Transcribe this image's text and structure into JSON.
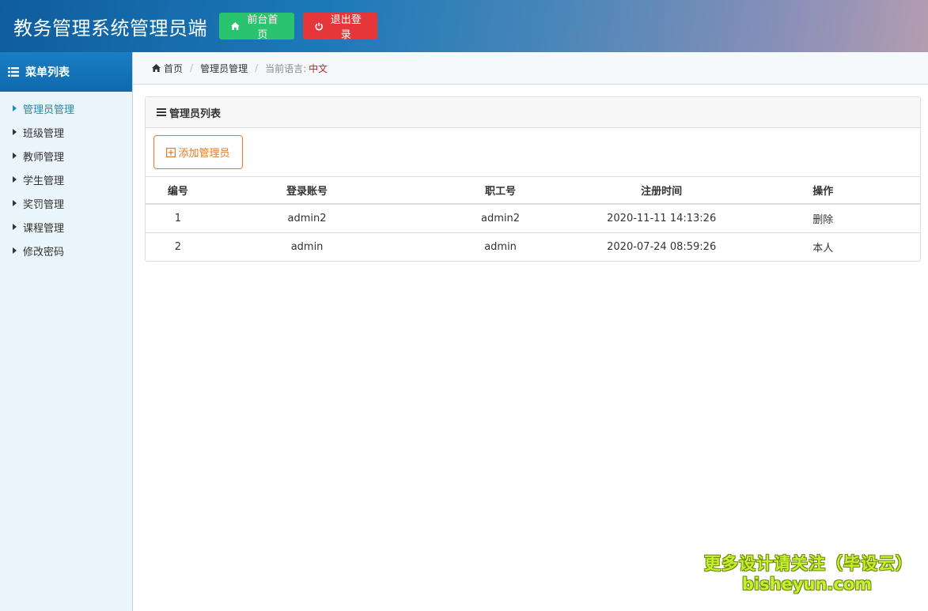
{
  "header": {
    "title": "教务管理系统管理员端",
    "home_button": "前台首页",
    "logout_button": "退出登录"
  },
  "sidebar": {
    "title": "菜单列表",
    "items": [
      {
        "label": "管理员管理",
        "active": true
      },
      {
        "label": "班级管理"
      },
      {
        "label": "教师管理"
      },
      {
        "label": "学生管理"
      },
      {
        "label": "奖罚管理"
      },
      {
        "label": "课程管理"
      },
      {
        "label": "修改密码"
      }
    ]
  },
  "breadcrumb": {
    "home": "首页",
    "current": "管理员管理",
    "lang_label": "当前语言:",
    "lang_value": "中文"
  },
  "panel": {
    "title": "管理员列表",
    "add_button": "添加管理员",
    "columns": [
      "编号",
      "登录账号",
      "职工号",
      "注册时间",
      "操作"
    ],
    "rows": [
      {
        "id": "1",
        "account": "admin2",
        "staff_no": "admin2",
        "registered": "2020-11-11 14:13:26",
        "action": "删除"
      },
      {
        "id": "2",
        "account": "admin",
        "staff_no": "admin",
        "registered": "2020-07-24 08:59:26",
        "action": "本人"
      }
    ]
  },
  "watermark": {
    "line1": "更多设计请关注（毕设云）",
    "line2": "bisheyun.com"
  },
  "colors": {
    "header_start": "#0f5d9e",
    "home_button": "#2ac36f",
    "logout_button": "#e5373a",
    "active_menu": "#1a8fb6",
    "add_button": "#e07a2a",
    "lang_value": "#d9181b"
  }
}
